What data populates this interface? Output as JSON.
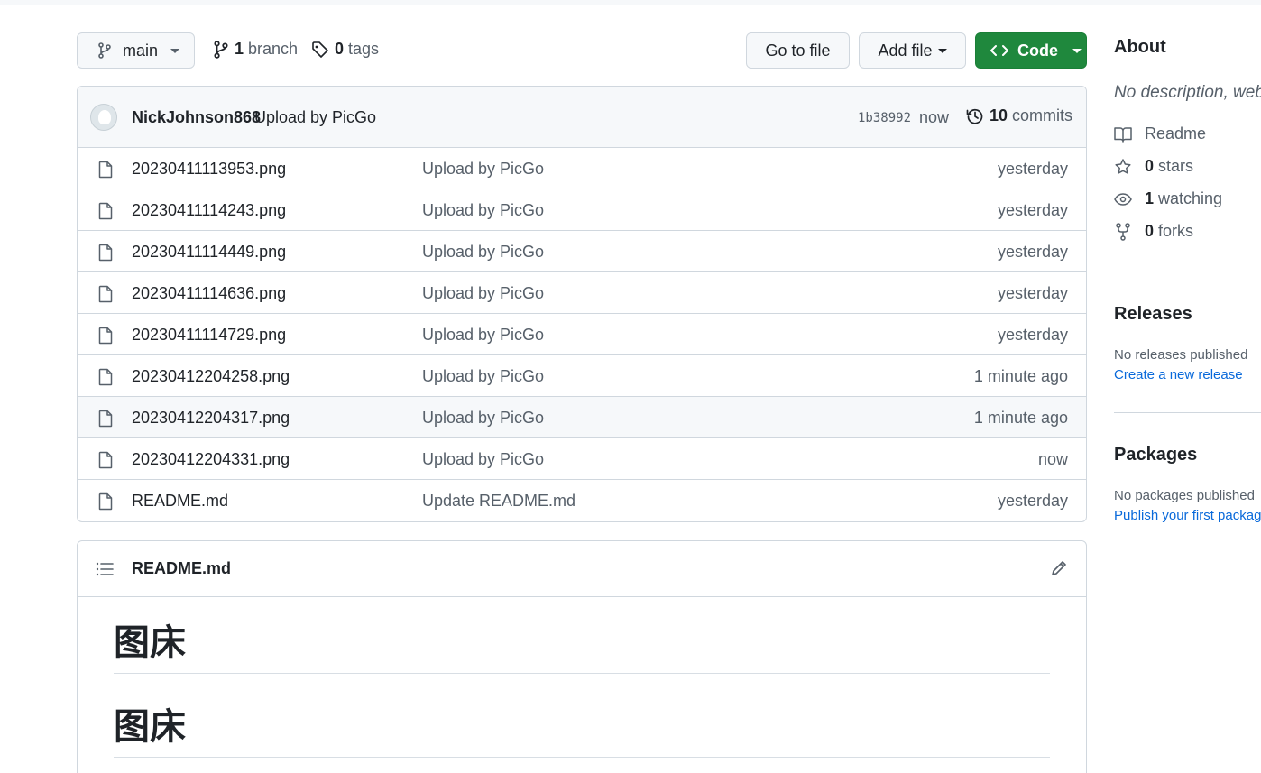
{
  "toolbar": {
    "branch_name": "main",
    "branch_count": "1",
    "branch_label": "branch",
    "tag_count": "0",
    "tag_label": "tags",
    "goto_file_label": "Go to file",
    "add_file_label": "Add file",
    "code_label": "Code",
    "code_button_color": "#1f883d"
  },
  "latest_commit": {
    "author": "NickJohnson868",
    "message": "Upload by PicGo",
    "sha": "1b38992",
    "time": "now",
    "commit_count": "10",
    "commit_label": "commits"
  },
  "files": [
    {
      "name": "20230411113953.png",
      "message": "Upload by PicGo",
      "time": "yesterday",
      "icon": "file-icon"
    },
    {
      "name": "20230411114243.png",
      "message": "Upload by PicGo",
      "time": "yesterday",
      "icon": "file-icon"
    },
    {
      "name": "20230411114449.png",
      "message": "Upload by PicGo",
      "time": "yesterday",
      "icon": "file-icon"
    },
    {
      "name": "20230411114636.png",
      "message": "Upload by PicGo",
      "time": "yesterday",
      "icon": "file-icon"
    },
    {
      "name": "20230411114729.png",
      "message": "Upload by PicGo",
      "time": "yesterday",
      "icon": "file-icon"
    },
    {
      "name": "20230412204258.png",
      "message": "Upload by PicGo",
      "time": "1 minute ago",
      "icon": "file-icon"
    },
    {
      "name": "20230412204317.png",
      "message": "Upload by PicGo",
      "time": "1 minute ago",
      "icon": "file-icon"
    },
    {
      "name": "20230412204331.png",
      "message": "Upload by PicGo",
      "time": "now",
      "icon": "file-icon"
    },
    {
      "name": "README.md",
      "message": "Update README.md",
      "time": "yesterday",
      "icon": "file-icon"
    }
  ],
  "readme": {
    "title": "README.md",
    "headings": [
      "图床",
      "图床"
    ]
  },
  "sidebar": {
    "about_title": "About",
    "description": "No description, website, or topics provided.",
    "readme_label": "Readme",
    "stars_count": "0",
    "stars_label": "stars",
    "watching_count": "1",
    "watching_label": "watching",
    "forks_count": "0",
    "forks_label": "forks",
    "releases_title": "Releases",
    "releases_none": "No releases published",
    "releases_link": "Create a new release",
    "packages_title": "Packages",
    "packages_none": "No packages published",
    "packages_link": "Publish your first package",
    "link_color": "#0969da"
  }
}
